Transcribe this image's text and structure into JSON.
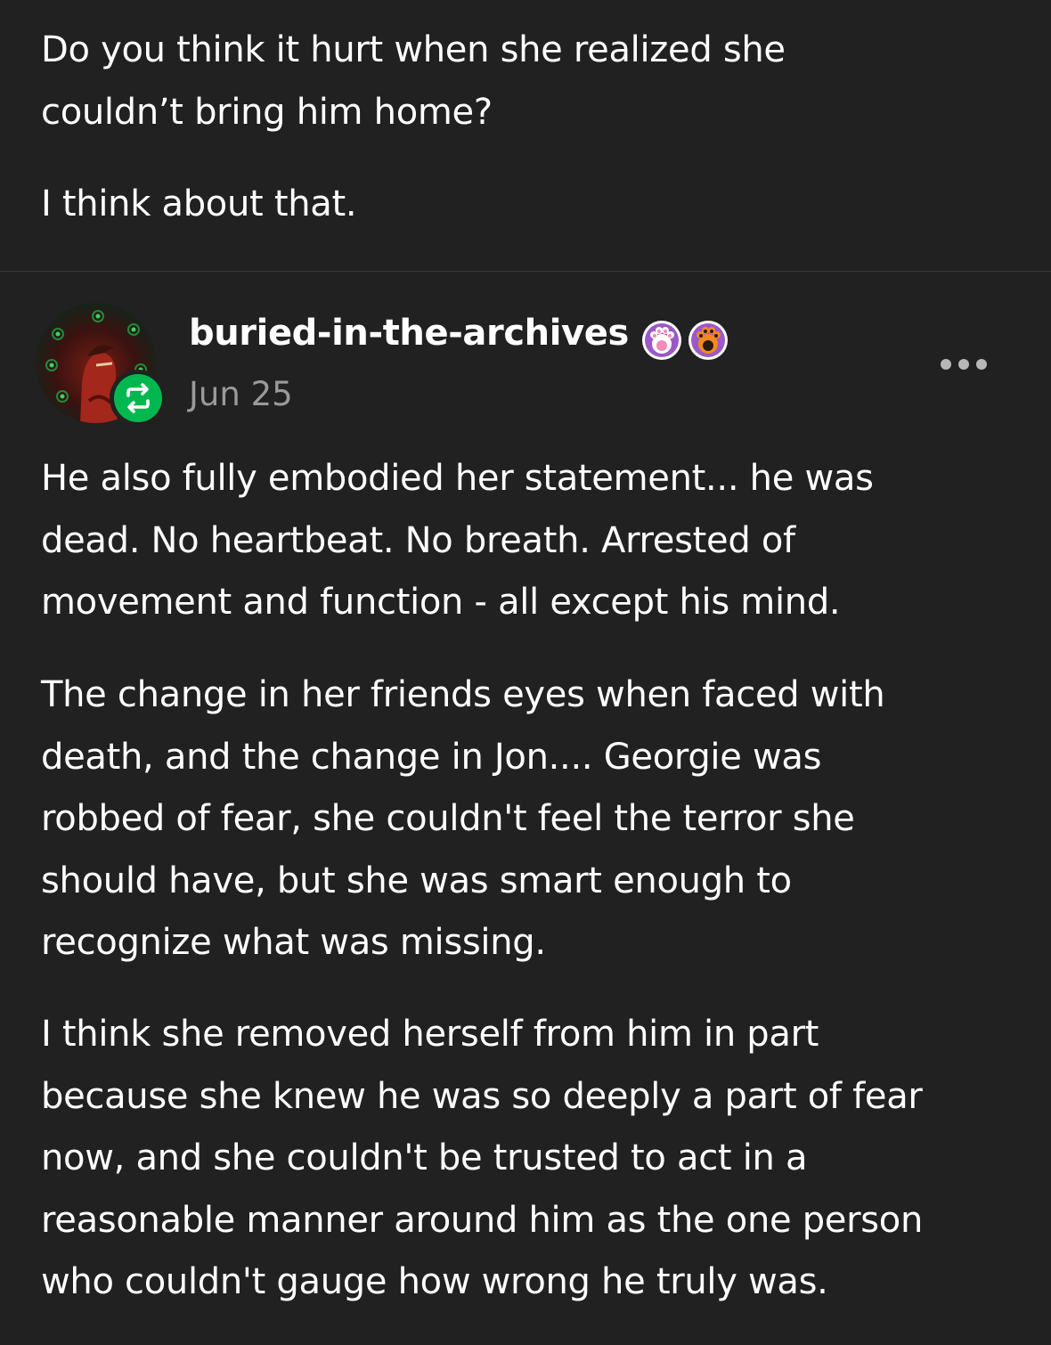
{
  "previous_post": {
    "paragraphs": [
      "Do you think it hurt when she realized she\ncouldn’t bring him home?",
      "I think about that."
    ]
  },
  "reblog": {
    "username": "buried-in-the-archives",
    "date": "Jun 25",
    "badges": [
      "paw-badge-purple",
      "paw-badge-orange"
    ],
    "more_icon": "ellipsis-icon",
    "reblog_icon": "reblog-icon",
    "colors": {
      "reblog_green": "#00b84f",
      "badge_purple": "#9b59c6",
      "badge_orange": "#f28a1e"
    },
    "paragraphs": [
      "He also fully embodied her statement... he was\ndead. No heartbeat. No breath. Arrested of\nmovement and function - all except his mind.",
      "The change in her friends eyes when faced with\ndeath, and the change in Jon.... Georgie was\nrobbed of fear, she couldn't feel the terror she\nshould have, but she was smart enough to\nrecognize what was missing.",
      "I think she removed herself from him in part\nbecause she knew he was so deeply a part of fear\nnow, and she couldn't be trusted to act in a\nreasonable manner around him as the one person\nwho couldn't gauge how wrong he truly was."
    ]
  }
}
